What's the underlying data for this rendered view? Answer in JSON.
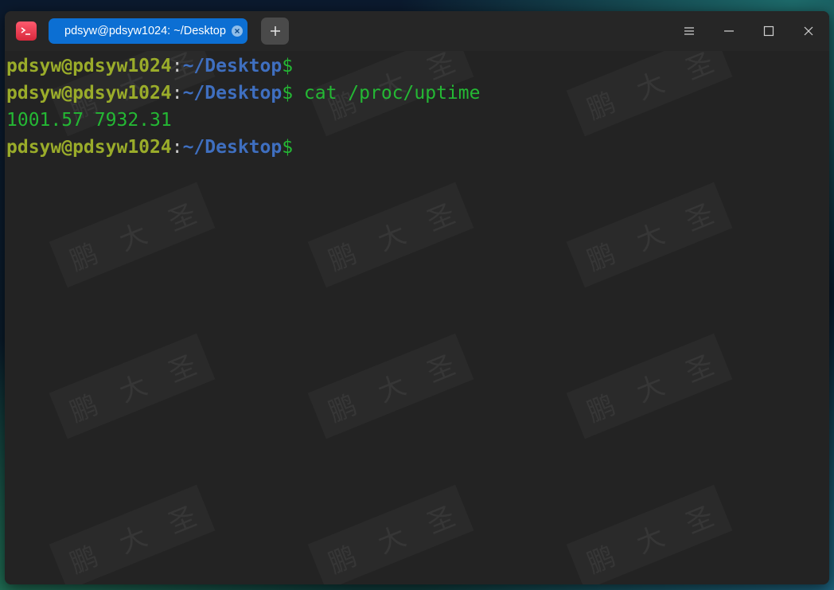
{
  "titlebar": {
    "tab_title": "pdsyw@pdsyw1024: ~/Desktop"
  },
  "icons": {
    "app": "terminal-icon",
    "tab_close": "close-icon",
    "new_tab": "plus-icon",
    "menu": "hamburger-menu-icon",
    "minimize": "minimize-icon",
    "maximize": "maximize-icon",
    "close": "close-icon"
  },
  "colors": {
    "tab_active": "#0c6fd3",
    "prompt_user": "#9aac2a",
    "prompt_path": "#3f6fc0",
    "prompt_symbol": "#24b834",
    "output": "#24b834",
    "terminal_bg": "#232323"
  },
  "terminal": {
    "lines": [
      {
        "user": "pdsyw@pdsyw1024",
        "sep": ":",
        "path": "~/Desktop",
        "symbol": "$",
        "command": ""
      },
      {
        "user": "pdsyw@pdsyw1024",
        "sep": ":",
        "path": "~/Desktop",
        "symbol": "$",
        "command": " cat /proc/uptime"
      },
      {
        "output": "1001.57 7932.31"
      },
      {
        "user": "pdsyw@pdsyw1024",
        "sep": ":",
        "path": "~/Desktop",
        "symbol": "$",
        "command": ""
      }
    ]
  },
  "watermark": {
    "chars": [
      "鹏",
      "大",
      "圣"
    ]
  }
}
